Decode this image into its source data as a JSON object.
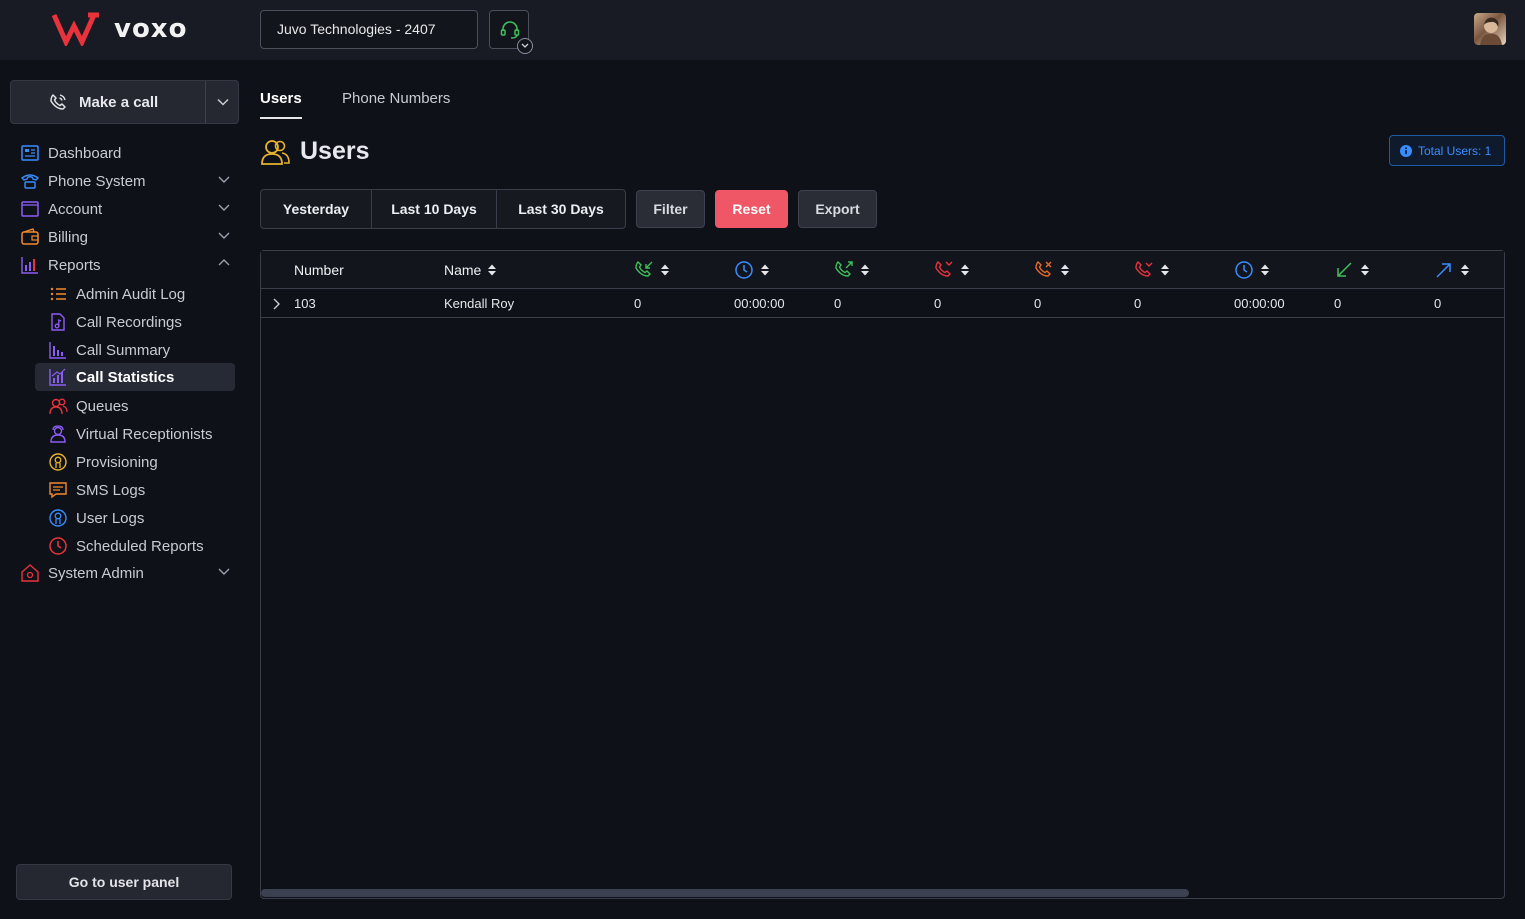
{
  "brand": {
    "name": "voxo",
    "accent": "#e8323c"
  },
  "header": {
    "company_select": "Juvo Technologies - 2407",
    "headset_icon": "headset-icon"
  },
  "sidebar": {
    "make_call": "Make a call",
    "items": [
      {
        "label": "Dashboard",
        "icon": "dashboard-icon"
      },
      {
        "label": "Phone System",
        "icon": "phone-icon"
      },
      {
        "label": "Account",
        "icon": "account-icon"
      },
      {
        "label": "Billing",
        "icon": "wallet-icon"
      },
      {
        "label": "Reports",
        "icon": "chart-icon"
      },
      {
        "label": "System Admin",
        "icon": "admin-icon"
      }
    ],
    "report_items": [
      {
        "label": "Admin Audit Log",
        "icon": "list-icon"
      },
      {
        "label": "Call Recordings",
        "icon": "recording-icon"
      },
      {
        "label": "Call Summary",
        "icon": "bar-chart-icon"
      },
      {
        "label": "Call Statistics",
        "icon": "statistics-icon",
        "active": true
      },
      {
        "label": "Queues",
        "icon": "queues-icon"
      },
      {
        "label": "Virtual Receptionists",
        "icon": "receptionist-icon"
      },
      {
        "label": "Provisioning",
        "icon": "provisioning-icon"
      },
      {
        "label": "SMS Logs",
        "icon": "sms-icon"
      },
      {
        "label": "User Logs",
        "icon": "user-log-icon"
      },
      {
        "label": "Scheduled Reports",
        "icon": "clock-icon"
      }
    ],
    "user_panel": "Go to user panel"
  },
  "main": {
    "tabs": [
      {
        "label": "Users",
        "active": true
      },
      {
        "label": "Phone Numbers"
      }
    ],
    "title": "Users",
    "total_badge": "Total Users: 1",
    "ranges": [
      "Yesterday",
      "Last 10 Days",
      "Last 30 Days"
    ],
    "buttons": {
      "filter": "Filter",
      "reset": "Reset",
      "export": "Export"
    },
    "table": {
      "columns": [
        {
          "label": "Number",
          "icon": ""
        },
        {
          "label": "Name",
          "icon": ""
        },
        {
          "label": "",
          "icon": "incoming-call-icon",
          "color": "#3fbf5a"
        },
        {
          "label": "",
          "icon": "clock-icon",
          "color": "#3a8dff"
        },
        {
          "label": "",
          "icon": "outgoing-call-icon",
          "color": "#3fbf5a"
        },
        {
          "label": "",
          "icon": "missed-call-icon",
          "color": "#e8323c"
        },
        {
          "label": "",
          "icon": "rejected-call-icon",
          "color": "#e86a2c"
        },
        {
          "label": "",
          "icon": "failed-call-icon",
          "color": "#e8323c"
        },
        {
          "label": "",
          "icon": "clock-icon",
          "color": "#3a8dff"
        },
        {
          "label": "",
          "icon": "inbound-arrow-icon",
          "color": "#3fbf5a"
        },
        {
          "label": "",
          "icon": "outbound-arrow-icon",
          "color": "#3a8dff"
        }
      ],
      "rows": [
        [
          "103",
          "Kendall Roy",
          "0",
          "00:00:00",
          "0",
          "0",
          "0",
          "0",
          "00:00:00",
          "0",
          "0"
        ]
      ]
    }
  }
}
